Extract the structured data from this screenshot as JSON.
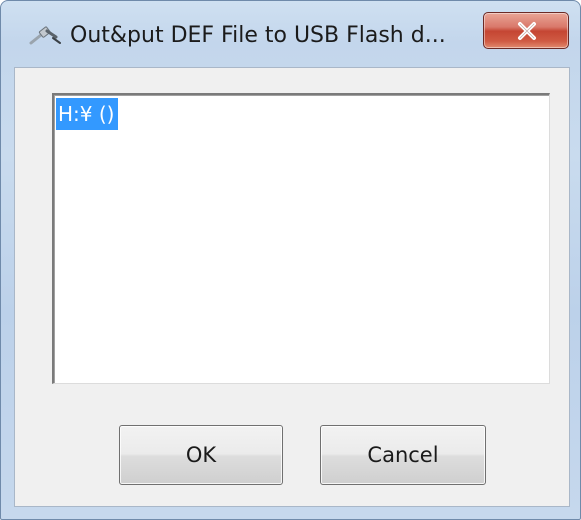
{
  "window": {
    "title": "Out&put DEF File to USB Flash d...",
    "icon": "usb-plug-icon",
    "close_icon": "close-x-icon",
    "accent_colors": {
      "close_button": "#c54633",
      "selection": "#3399ff"
    }
  },
  "drive_list": {
    "items": [
      {
        "label": "H:¥ ()",
        "selected": true
      }
    ]
  },
  "buttons": {
    "ok_label": "OK",
    "cancel_label": "Cancel"
  }
}
